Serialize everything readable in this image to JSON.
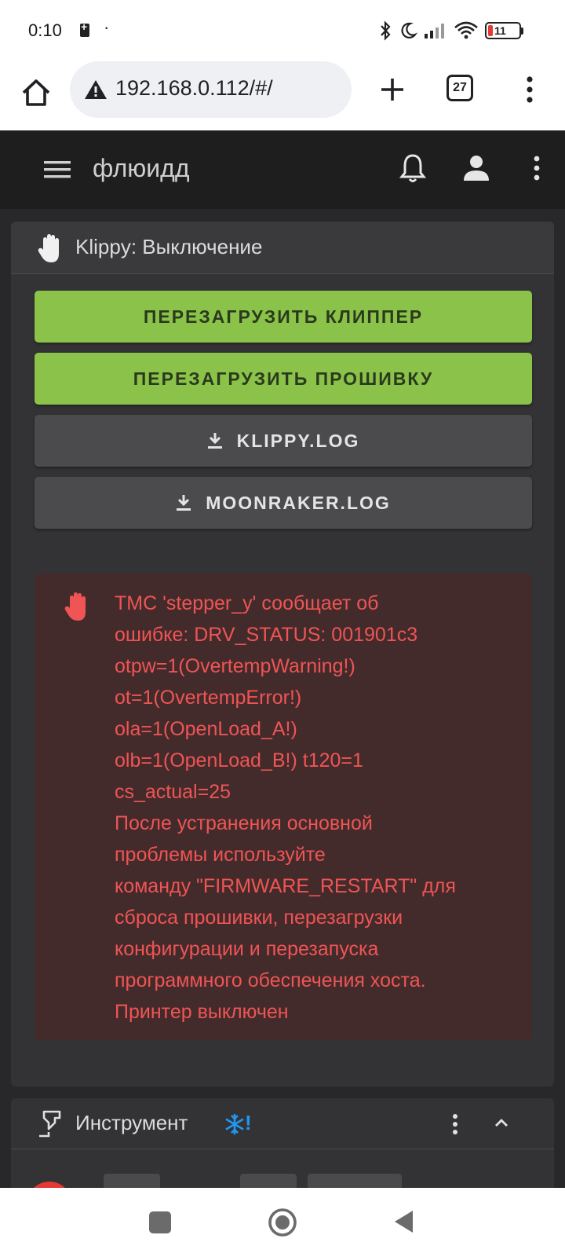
{
  "status_bar": {
    "time": "0:10",
    "dot": "·",
    "battery_level": "11"
  },
  "browser": {
    "url": "192.168.0.112/#/",
    "tabs_count": "27"
  },
  "app": {
    "title": "флюидд"
  },
  "klippy_card": {
    "title": "Klippy: Выключение",
    "buttons": {
      "restart_klipper": "ПЕРЕЗАГРУЗИТЬ КЛИППЕР",
      "restart_firmware": "ПЕРЕЗАГРУЗИТЬ ПРОШИВКУ",
      "klippy_log": "KLIPPY.LOG",
      "moonraker_log": "MOONRAKER.LOG"
    },
    "alert_text": "TMC 'stepper_y' сообщает об\nошибке: DRV_STATUS: 001901c3\notpw=1(OvertempWarning!)\not=1(OvertempError!)\nola=1(OpenLoad_A!)\nolb=1(OpenLoad_B!) t120=1\ncs_actual=25\nПосле устранения основной\nпроблемы используйте\nкоманду \"FIRMWARE_RESTART\" для\nсброса прошивки, перезагрузки\nконфигурации и перезапуска\nпрограммного обеспечения хоста.\nПринтер выключен"
  },
  "tool_card": {
    "title": "Инструмент",
    "warn_mark": "!"
  },
  "colors": {
    "accent_green": "#8bc34a",
    "error_red": "#f05454",
    "card_bg": "#333335",
    "page_bg": "#28282b"
  },
  "icons": {
    "home": "home-icon",
    "warning": "warning-icon",
    "hand": "hand-stop-icon",
    "download": "download-icon",
    "bell": "bell-icon",
    "account": "account-icon",
    "menu": "hamburger-menu-icon",
    "tool": "tool-icon",
    "snowflake": "snowflake-icon"
  }
}
